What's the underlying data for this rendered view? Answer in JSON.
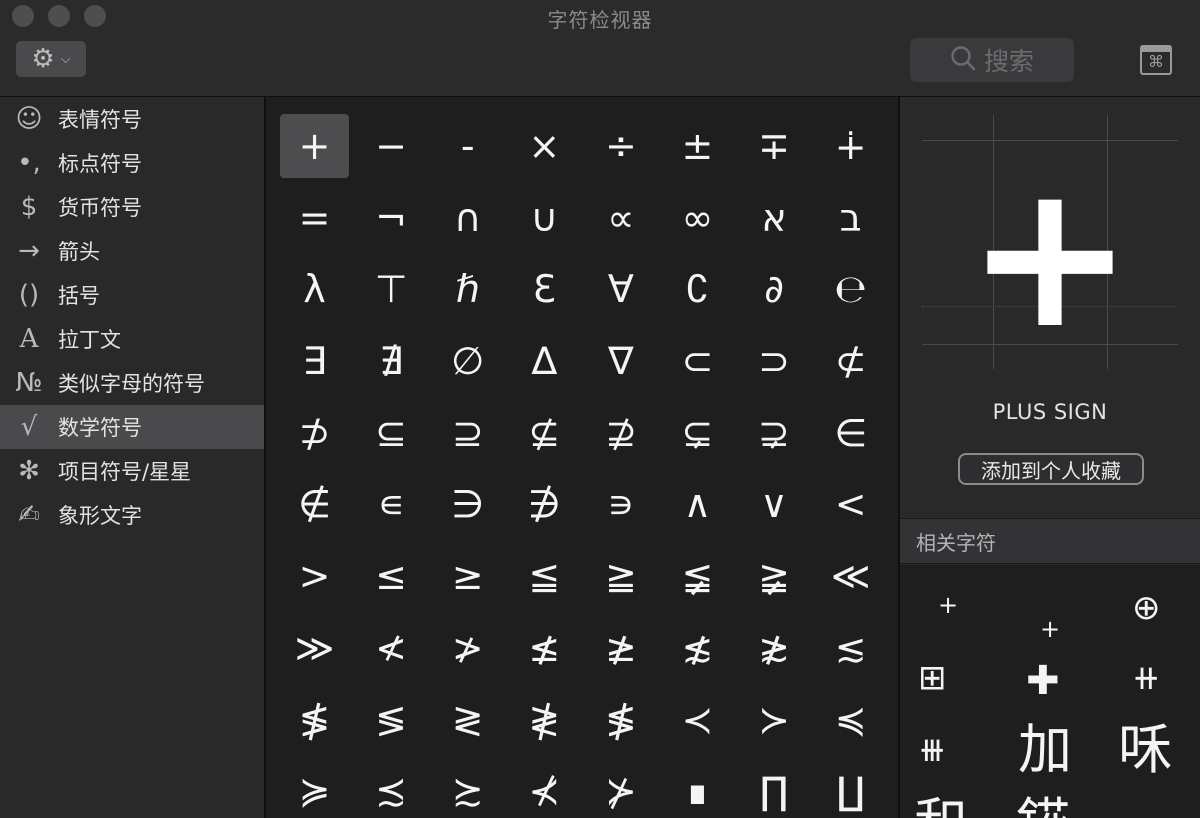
{
  "window": {
    "title": "字符检视器"
  },
  "toolbar": {
    "gear_icon": "gear-icon",
    "search_placeholder": "搜索"
  },
  "sidebar": {
    "items": [
      {
        "icon": "☺",
        "label": "表情符号",
        "active": false
      },
      {
        "icon": "•,",
        "label": "标点符号",
        "active": false
      },
      {
        "icon": "$",
        "label": "货币符号",
        "active": false
      },
      {
        "icon": "→",
        "label": "箭头",
        "active": false
      },
      {
        "icon": "()",
        "label": "括号",
        "active": false
      },
      {
        "icon": "A",
        "label": "拉丁文",
        "active": false
      },
      {
        "icon": "№",
        "label": "类似字母的符号",
        "active": false
      },
      {
        "icon": "√",
        "label": "数学符号",
        "active": true
      },
      {
        "icon": "✻",
        "label": "项目符号/星星",
        "active": false
      },
      {
        "icon": "✍",
        "label": "象形文字",
        "active": false
      }
    ]
  },
  "characters": [
    "+",
    "−",
    "-",
    "×",
    "÷",
    "±",
    "∓",
    "∔",
    "=",
    "¬",
    "∩",
    "∪",
    "∝",
    "∞",
    "א",
    "ב",
    "λ",
    "⊤",
    "ℏ",
    "ℇ",
    "∀",
    "∁",
    "∂",
    "℮",
    "∃",
    "∄",
    "∅",
    "∆",
    "∇",
    "⊂",
    "⊃",
    "⊄",
    "⊅",
    "⊆",
    "⊇",
    "⊈",
    "⊉",
    "⊊",
    "⊋",
    "∈",
    "∉",
    "∊",
    "∋",
    "∌",
    "∍",
    "∧",
    "∨",
    "<",
    ">",
    "≤",
    "≥",
    "≦",
    "≧",
    "≨",
    "≩",
    "≪",
    "≫",
    "≮",
    "≯",
    "≰",
    "≱",
    "≴",
    "≵",
    "≲",
    "≸",
    "≶",
    "≷",
    "≹",
    "≸",
    "≺",
    "≻",
    "≼",
    "≽",
    "≾",
    "≿",
    "⊀",
    "⊁",
    "∎",
    "∏",
    "∐"
  ],
  "selected_index": 0,
  "detail": {
    "character": "+",
    "name": "PLUS SIGN",
    "add_favorite_label": "添加到个人收藏"
  },
  "related": {
    "header": "相关字符",
    "chars": [
      "+",
      "+",
      "⊕",
      "⊞",
      "✚",
      "⧺",
      "⧻",
      "加",
      "咊",
      "和",
      "錵"
    ]
  }
}
